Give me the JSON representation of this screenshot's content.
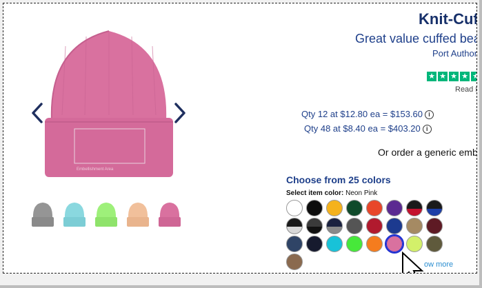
{
  "product": {
    "title": "Knit-Cuff",
    "subtitle": "Great value cuffed bea",
    "brand": "Port Author",
    "read_reviews": "Read Re",
    "embellishment_label": "Embellishment Area",
    "main_color": "#d9719f"
  },
  "pricing": {
    "qty12": "Qty 12 at $12.80 ea = $153.60",
    "qty48": "Qty 48 at $8.40 ea = $403.20",
    "generic": "Or order a generic embro"
  },
  "colors": {
    "heading": "Choose from 25 colors",
    "select_label": "Select item color:",
    "selected_name": "Neon Pink",
    "show_more": "ow more",
    "swatches": [
      {
        "name": "white",
        "color": "#ffffff"
      },
      {
        "name": "black",
        "color": "#0d0d0d"
      },
      {
        "name": "gold",
        "color": "#f5b21c"
      },
      {
        "name": "dark-green",
        "color": "#0f4a2a"
      },
      {
        "name": "orange-red",
        "color": "#e8462a"
      },
      {
        "name": "purple",
        "color": "#5b2a91"
      },
      {
        "name": "black-red",
        "color": "#1a1a1a",
        "accent": "#c4122f"
      },
      {
        "name": "black-royal",
        "color": "#1a1a1a",
        "accent": "#1d3fa8"
      },
      {
        "name": "black-white",
        "color": "#1a1a1a",
        "accent": "#d8d8d8"
      },
      {
        "name": "charcoal-black",
        "color": "#3a3a3a",
        "accent": "#111111"
      },
      {
        "name": "navy-grey",
        "color": "#1b2240",
        "accent": "#8a8a8a"
      },
      {
        "name": "dark-grey",
        "color": "#555555"
      },
      {
        "name": "red",
        "color": "#b11a2e"
      },
      {
        "name": "royal",
        "color": "#1c3a8f"
      },
      {
        "name": "khaki",
        "color": "#a58a63"
      },
      {
        "name": "maroon",
        "color": "#5e1a24"
      },
      {
        "name": "slate-blue",
        "color": "#2f4466"
      },
      {
        "name": "dark-navy",
        "color": "#161a2e"
      },
      {
        "name": "turquoise",
        "color": "#18c2d8"
      },
      {
        "name": "neon-green",
        "color": "#47e83a"
      },
      {
        "name": "neon-orange",
        "color": "#f57c1e"
      },
      {
        "name": "neon-pink",
        "color": "#d9719f",
        "selected": true
      },
      {
        "name": "lime",
        "color": "#d3f06a"
      },
      {
        "name": "olive",
        "color": "#5f5a3c"
      },
      {
        "name": "brown",
        "color": "#8a6a4f"
      }
    ]
  },
  "thumbnails": [
    {
      "name": "grey",
      "color": "#959595"
    },
    {
      "name": "aqua",
      "color": "#8ad8df"
    },
    {
      "name": "lime",
      "color": "#9ef07a"
    },
    {
      "name": "peach",
      "color": "#f1c09b"
    },
    {
      "name": "pink",
      "color": "#d9719f"
    }
  ]
}
